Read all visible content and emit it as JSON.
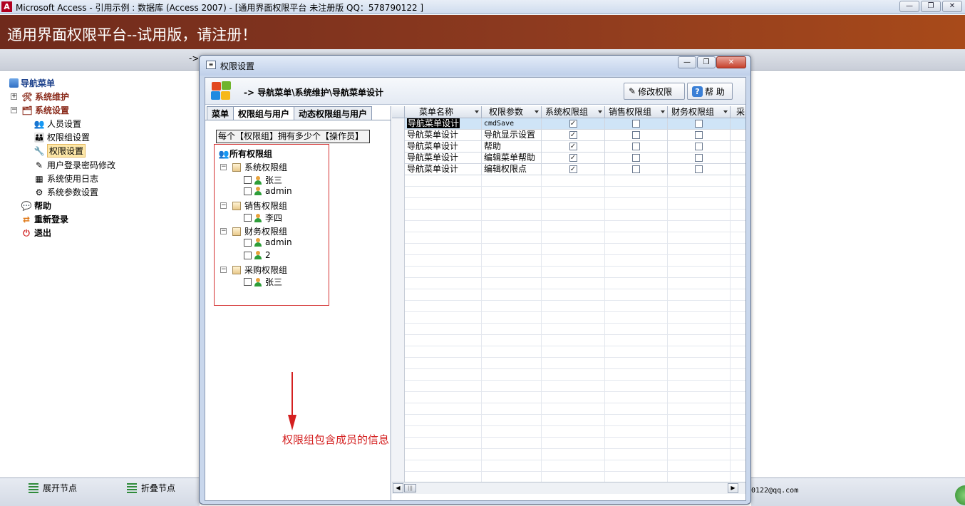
{
  "app": {
    "logo": "A",
    "title": "Microsoft Access - 引用示例 : 数据库 (Access 2007) - [通用界面权限平台  未注册版 QQ：578790122  ]",
    "window_buttons": [
      "—",
      "❐",
      "✕"
    ]
  },
  "banner": {
    "text": "通用界面权限平台--试用版，请注册！"
  },
  "hint_arrow": "->",
  "nav": {
    "root": "导航菜单",
    "items": [
      {
        "label": "系统维护",
        "expand": "+"
      },
      {
        "label": "系统设置",
        "expand": "−"
      },
      {
        "label": "人员设置"
      },
      {
        "label": "权限组设置"
      },
      {
        "label": "权限设置"
      },
      {
        "label": "用户登录密码修改"
      },
      {
        "label": "系统使用日志"
      },
      {
        "label": "系统参数设置"
      },
      {
        "label": "帮助"
      },
      {
        "label": "重新登录"
      },
      {
        "label": "退出"
      }
    ],
    "expand_label": "展开节点",
    "collapse_label": "折叠节点"
  },
  "status": {
    "email_fragment": "0122@qq.com"
  },
  "dialog": {
    "icon": "≡",
    "title": "权限设置",
    "buttons": [
      "—",
      "❐",
      "✕"
    ],
    "path": "-> 导航菜单\\系统维护\\导航菜单设计",
    "edit_button": "修改权限",
    "help_button": "帮 助",
    "help_icon": "?",
    "tabs": [
      "菜单",
      "权限组与用户",
      "动态权限组与用户"
    ],
    "group_header": "每个【权限组】拥有多少个【操作员】",
    "tree": {
      "root": "所有权限组",
      "groups": [
        {
          "name": "系统权限组",
          "members": [
            "张三",
            "admin"
          ]
        },
        {
          "name": "销售权限组",
          "members": [
            "李四"
          ]
        },
        {
          "name": "财务权限组",
          "members": [
            "admin",
            "2"
          ]
        },
        {
          "name": "采购权限组",
          "members": [
            "张三"
          ]
        }
      ]
    },
    "annotation": "权限组包含成员的信息",
    "grid": {
      "columns": [
        "菜单名称",
        "权限参数",
        "系统权限组",
        "销售权限组",
        "财务权限组",
        "采"
      ],
      "rows": [
        {
          "name": "导航菜单设计",
          "param": "cmdSave",
          "sys": true,
          "sales": false,
          "fin": false
        },
        {
          "name": "导航菜单设计",
          "param": "导航显示设置",
          "sys": true,
          "sales": false,
          "fin": false
        },
        {
          "name": "导航菜单设计",
          "param": "帮助",
          "sys": true,
          "sales": false,
          "fin": false
        },
        {
          "name": "导航菜单设计",
          "param": "编辑菜单帮助",
          "sys": true,
          "sales": false,
          "fin": false
        },
        {
          "name": "导航菜单设计",
          "param": "编辑权限点",
          "sys": true,
          "sales": false,
          "fin": false
        }
      ],
      "check_mark": "✓"
    }
  }
}
